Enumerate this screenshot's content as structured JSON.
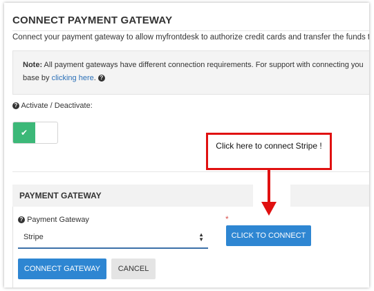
{
  "header": {
    "title": "CONNECT PAYMENT GATEWAY",
    "description": "Connect your payment gateway to allow myfrontdesk to authorize credit cards and transfer the funds to"
  },
  "note": {
    "label": "Note:",
    "text1": " All payment gateways have different connection requirements. For support with connecting you",
    "text2_prefix": "base by ",
    "link": "clicking here",
    "text2_suffix": ". "
  },
  "activate": {
    "label": "Activate / Deactivate:",
    "state": "on",
    "check_glyph": "✔"
  },
  "payment_gateway": {
    "section_title": "PAYMENT GATEWAY",
    "field_label": "Payment Gateway",
    "selected_value": "Stripe",
    "required_marker": "*",
    "connect_button": "CLICK TO CONNECT"
  },
  "actions": {
    "connect_gateway": "CONNECT GATEWAY",
    "cancel": "CANCEL"
  },
  "callout": {
    "text": "Click here to connect Stripe !",
    "color": "#e01010"
  },
  "icons": {
    "help": "question-circle-icon",
    "select_arrow": "sort-icon"
  },
  "colors": {
    "primary": "#2e86d2",
    "toggle_on": "#3cb878",
    "link": "#2a6fb7",
    "required": "#d9534f"
  }
}
